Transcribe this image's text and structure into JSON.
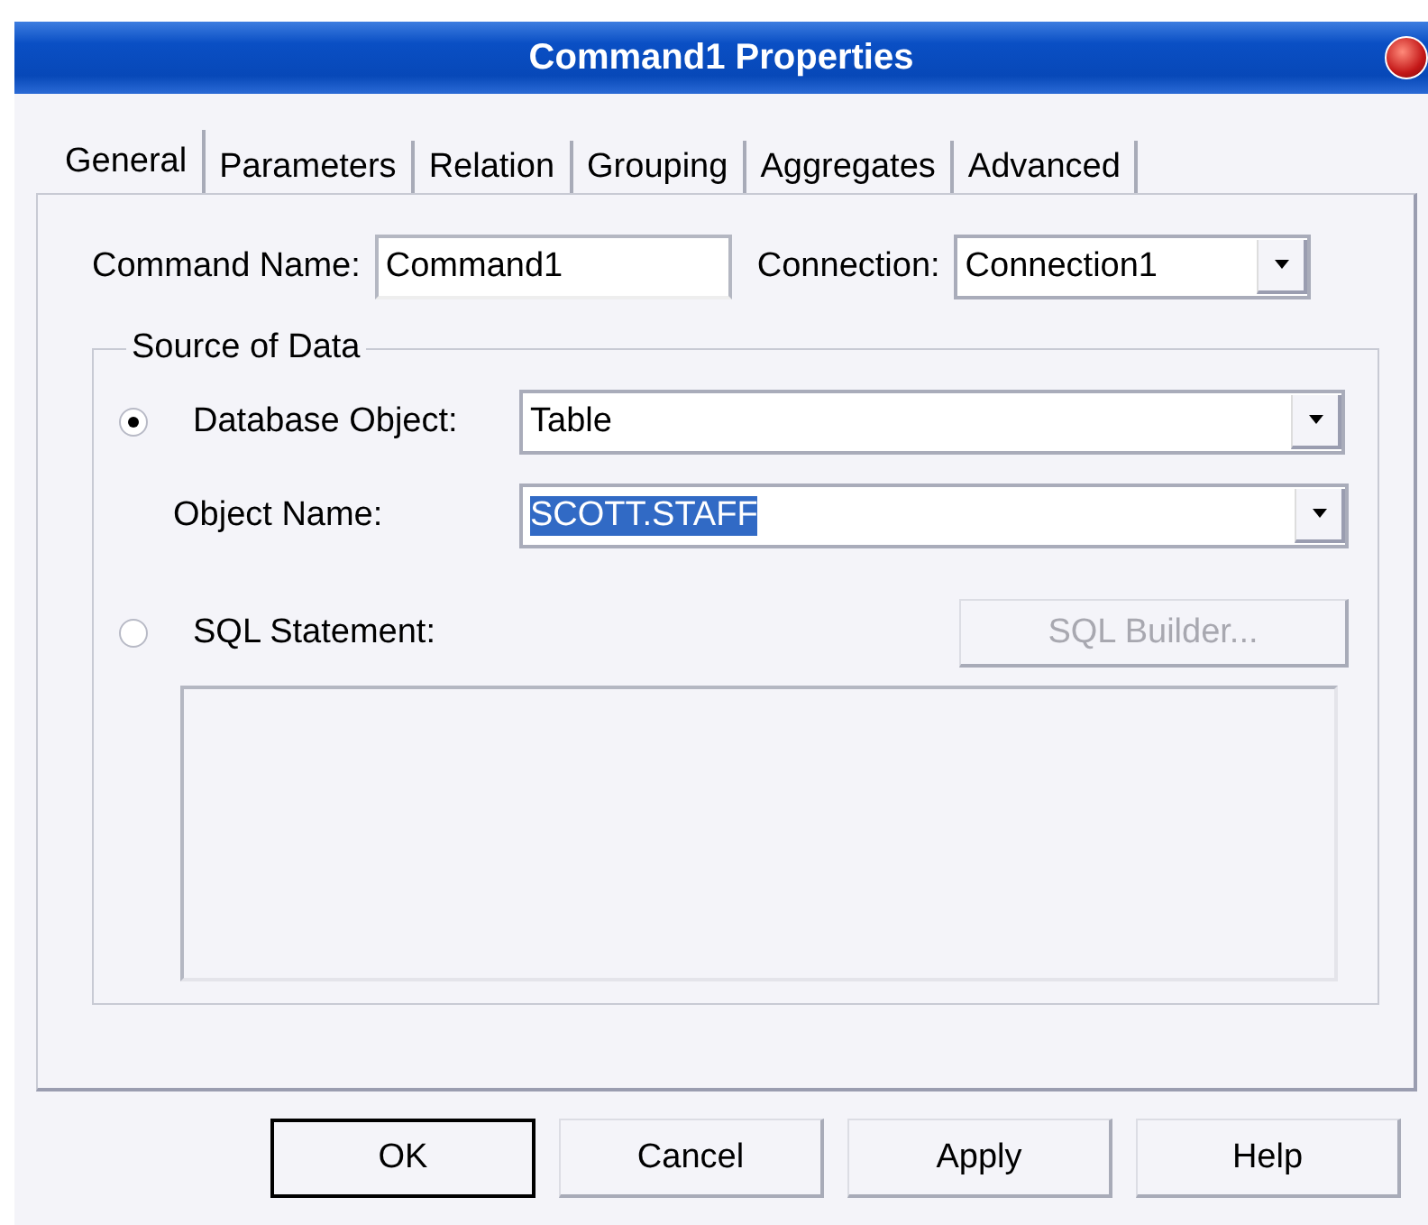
{
  "window": {
    "title": "Command1 Properties"
  },
  "tabs": [
    {
      "label": "General",
      "selected": true
    },
    {
      "label": "Parameters",
      "selected": false
    },
    {
      "label": "Relation",
      "selected": false
    },
    {
      "label": "Grouping",
      "selected": false
    },
    {
      "label": "Aggregates",
      "selected": false
    },
    {
      "label": "Advanced",
      "selected": false
    }
  ],
  "command_name": {
    "label": "Command Name:",
    "value": "Command1"
  },
  "connection": {
    "label": "Connection:",
    "value": "Connection1"
  },
  "source_of_data": {
    "title": "Source of Data",
    "options": [
      {
        "kind": "database_object",
        "label": "Database Object:",
        "selected": true,
        "value": "Table"
      },
      {
        "kind": "sql_statement",
        "label": "SQL Statement:",
        "selected": false
      }
    ],
    "object_name": {
      "label": "Object Name:",
      "value": "SCOTT.STAFF",
      "highlighted": true
    },
    "sql_builder": {
      "label": "SQL Builder...",
      "disabled": true
    },
    "sql_text": {
      "disabled": true
    }
  },
  "buttons": [
    {
      "label": "OK",
      "default": true
    },
    {
      "label": "Cancel",
      "default": false
    },
    {
      "label": "Apply",
      "default": false
    },
    {
      "label": "Help",
      "default": false
    }
  ]
}
